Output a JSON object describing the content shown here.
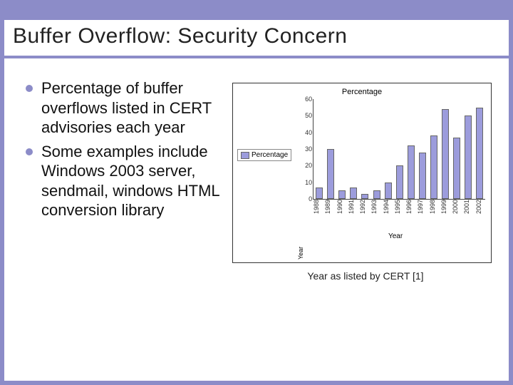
{
  "slide": {
    "title": "Buffer Overflow: Security Concern",
    "bullets": [
      "Percentage of buffer overflows listed in CERT advisories each year",
      "Some examples include Windows 2003 server, sendmail, windows HTML conversion library"
    ],
    "caption": "Year as listed by CERT [1]"
  },
  "chart_data": {
    "type": "bar",
    "title": "Percentage",
    "legend": [
      "Percentage"
    ],
    "xlabel": "Year",
    "ylabel": "Year",
    "ylim": [
      0,
      60
    ],
    "yticks": [
      0,
      10,
      20,
      30,
      40,
      50,
      60
    ],
    "categories": [
      "1988",
      "1989",
      "1990",
      "1991",
      "1992",
      "1993",
      "1994",
      "1995",
      "1996",
      "1997",
      "1998",
      "1999",
      "2000",
      "2001",
      "2002"
    ],
    "values": [
      7,
      30,
      5,
      7,
      3,
      5,
      10,
      20,
      32,
      28,
      38,
      54,
      37,
      50,
      55
    ]
  }
}
